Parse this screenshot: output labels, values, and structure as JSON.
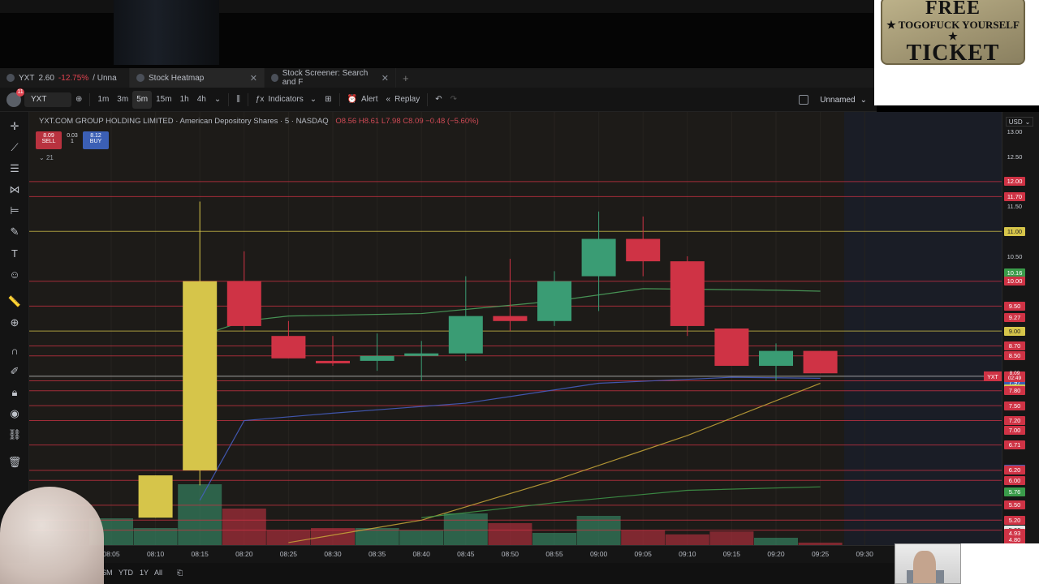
{
  "tabs": [
    {
      "icon": "tradingview-icon",
      "label": "YXT",
      "price": "2.60",
      "change": "-12.75%",
      "suffix": "/ Unna",
      "active": false
    },
    {
      "icon": "heatmap-icon",
      "label": "Stock Heatmap",
      "active": true
    },
    {
      "icon": "screener-icon",
      "label": "Stock Screener: Search and F",
      "active": false
    }
  ],
  "toolbar": {
    "avatar_badge": "11",
    "symbol": "YXT",
    "intervals": [
      "1m",
      "3m",
      "5m",
      "15m",
      "1h",
      "4h"
    ],
    "selected_interval": "5m",
    "indicators": "Indicators",
    "alert": "Alert",
    "replay": "Replay",
    "layout_name": "Unnamed"
  },
  "legend": {
    "title": "YXT.COM GROUP HOLDING LIMITED · American Depository Shares · 5 · NASDAQ",
    "ohlc": "O8.56 H8.61 L7.98 C8.09 −0.48 (−5.60%)"
  },
  "trade": {
    "sell_price": "8.09",
    "sell_label": "SELL",
    "spread": "0.03",
    "qty": "1",
    "buy_price": "8.12",
    "buy_label": "BUY"
  },
  "interval_tag": "21",
  "currency": "USD",
  "colors": {
    "up": "#3a9c74",
    "down": "#cf3345",
    "yellow": "#d6c54a",
    "bg": "#1d1b18"
  },
  "chart_data": {
    "type": "candlestick",
    "x": [
      "08:05",
      "08:10",
      "08:15",
      "08:20",
      "08:25",
      "08:30",
      "08:35",
      "08:40",
      "08:45",
      "08:50",
      "08:55",
      "09:00",
      "09:05",
      "09:10",
      "09:15",
      "09:20",
      "09:25"
    ],
    "ohlc": [
      {
        "t": "08:10",
        "o": 5.25,
        "h": 5.6,
        "l": 5.25,
        "c": 6.1,
        "color": "yellow"
      },
      {
        "t": "08:15",
        "o": 6.2,
        "h": 11.6,
        "l": 5.9,
        "c": 10.0,
        "color": "yellow"
      },
      {
        "t": "08:20",
        "o": 10.0,
        "h": 10.6,
        "l": 9.0,
        "c": 9.1,
        "color": "down"
      },
      {
        "t": "08:25",
        "o": 8.9,
        "h": 9.2,
        "l": 8.45,
        "c": 8.45,
        "color": "down"
      },
      {
        "t": "08:30",
        "o": 8.4,
        "h": 8.9,
        "l": 8.3,
        "c": 8.35,
        "color": "down"
      },
      {
        "t": "08:35",
        "o": 8.4,
        "h": 8.95,
        "l": 8.2,
        "c": 8.5,
        "color": "up"
      },
      {
        "t": "08:40",
        "o": 8.5,
        "h": 8.8,
        "l": 8.0,
        "c": 8.55,
        "color": "up"
      },
      {
        "t": "08:45",
        "o": 8.55,
        "h": 10.1,
        "l": 8.4,
        "c": 9.3,
        "color": "up"
      },
      {
        "t": "08:50",
        "o": 9.3,
        "h": 10.45,
        "l": 9.0,
        "c": 9.2,
        "color": "down"
      },
      {
        "t": "08:55",
        "o": 9.2,
        "h": 10.2,
        "l": 9.1,
        "c": 10.0,
        "color": "up"
      },
      {
        "t": "09:00",
        "o": 10.1,
        "h": 11.4,
        "l": 9.4,
        "c": 10.85,
        "color": "up"
      },
      {
        "t": "09:05",
        "o": 10.85,
        "h": 11.3,
        "l": 10.1,
        "c": 10.4,
        "color": "down"
      },
      {
        "t": "09:10",
        "o": 10.4,
        "h": 10.5,
        "l": 8.9,
        "c": 9.1,
        "color": "down"
      },
      {
        "t": "09:15",
        "o": 9.05,
        "h": 9.05,
        "l": 8.3,
        "c": 8.3,
        "color": "down"
      },
      {
        "t": "09:20",
        "o": 8.3,
        "h": 8.75,
        "l": 8.0,
        "c": 8.6,
        "color": "up"
      },
      {
        "t": "09:25",
        "o": 8.6,
        "h": 8.6,
        "l": 8.15,
        "c": 8.15,
        "color": "down"
      }
    ],
    "volume": [
      {
        "t": "08:05",
        "v": 0.55,
        "color": "up"
      },
      {
        "t": "08:10",
        "v": 0.35,
        "color": "up"
      },
      {
        "t": "08:15",
        "v": 1.25,
        "color": "up"
      },
      {
        "t": "08:20",
        "v": 0.75,
        "color": "down"
      },
      {
        "t": "08:25",
        "v": 0.3,
        "color": "down"
      },
      {
        "t": "08:30",
        "v": 0.35,
        "color": "down"
      },
      {
        "t": "08:35",
        "v": 0.35,
        "color": "up"
      },
      {
        "t": "08:40",
        "v": 0.3,
        "color": "up"
      },
      {
        "t": "08:45",
        "v": 0.65,
        "color": "up"
      },
      {
        "t": "08:50",
        "v": 0.45,
        "color": "down"
      },
      {
        "t": "08:55",
        "v": 0.25,
        "color": "up"
      },
      {
        "t": "09:00",
        "v": 0.6,
        "color": "up"
      },
      {
        "t": "09:05",
        "v": 0.3,
        "color": "down"
      },
      {
        "t": "09:10",
        "v": 0.22,
        "color": "down"
      },
      {
        "t": "09:15",
        "v": 0.28,
        "color": "down"
      },
      {
        "t": "09:20",
        "v": 0.15,
        "color": "up"
      },
      {
        "t": "09:25",
        "v": 0.05,
        "color": "down"
      }
    ],
    "ylim": [
      4.7,
      13.4
    ],
    "hlines": [
      {
        "y": 12.0,
        "color": "#cf3345"
      },
      {
        "y": 11.7,
        "color": "#cf3345"
      },
      {
        "y": 11.0,
        "color": "#d6c54a"
      },
      {
        "y": 10.0,
        "color": "#cf3345"
      },
      {
        "y": 9.5,
        "color": "#cf3345"
      },
      {
        "y": 9.0,
        "color": "#d6c54a"
      },
      {
        "y": 8.7,
        "color": "#cf3345"
      },
      {
        "y": 8.5,
        "color": "#cf3345"
      },
      {
        "y": 8.09,
        "color": "#c8c8c8"
      },
      {
        "y": 8.0,
        "color": "#cf3345"
      },
      {
        "y": 7.8,
        "color": "#cf3345"
      },
      {
        "y": 7.5,
        "color": "#cf3345"
      },
      {
        "y": 7.2,
        "color": "#cf3345"
      },
      {
        "y": 6.71,
        "color": "#cf3345"
      },
      {
        "y": 6.2,
        "color": "#cf3345"
      },
      {
        "y": 6.0,
        "color": "#cf3345"
      },
      {
        "y": 5.5,
        "color": "#cf3345"
      },
      {
        "y": 5.2,
        "color": "#cf3345"
      },
      {
        "y": 5.0,
        "color": "#cf3345"
      }
    ],
    "price_labels": [
      {
        "y": 13.0,
        "text": "13.00",
        "bg": "",
        "fg": "#c8ccd3"
      },
      {
        "y": 12.5,
        "text": "12.50",
        "bg": "",
        "fg": "#c8ccd3"
      },
      {
        "y": 12.0,
        "text": "12.00",
        "bg": "#cf3345",
        "fg": "#fff"
      },
      {
        "y": 11.7,
        "text": "11.70",
        "bg": "#cf3345",
        "fg": "#fff"
      },
      {
        "y": 11.5,
        "text": "11.50",
        "bg": "",
        "fg": "#c8ccd3"
      },
      {
        "y": 11.0,
        "text": "11.00",
        "bg": "#d6c54a",
        "fg": "#222"
      },
      {
        "y": 10.5,
        "text": "10.50",
        "bg": "",
        "fg": "#c8ccd3"
      },
      {
        "y": 10.16,
        "text": "10.16",
        "bg": "#3a9c4a",
        "fg": "#fff"
      },
      {
        "y": 10.0,
        "text": "10.00",
        "bg": "#cf3345",
        "fg": "#fff"
      },
      {
        "y": 9.5,
        "text": "9.50",
        "bg": "#cf3345",
        "fg": "#fff"
      },
      {
        "y": 9.27,
        "text": "9.27",
        "bg": "#cf3345",
        "fg": "#fff"
      },
      {
        "y": 9.0,
        "text": "9.00",
        "bg": "#d6c54a",
        "fg": "#222"
      },
      {
        "y": 8.7,
        "text": "8.70",
        "bg": "#cf3345",
        "fg": "#fff"
      },
      {
        "y": 8.5,
        "text": "8.50",
        "bg": "#cf3345",
        "fg": "#fff"
      },
      {
        "y": 8.0,
        "text": "8.00",
        "bg": "#e8e8e8",
        "fg": "#222"
      },
      {
        "y": 7.97,
        "text": "7.97",
        "bg": "#3b5fb5",
        "fg": "#fff"
      },
      {
        "y": 7.84,
        "text": "7.84",
        "bg": "#d6c54a",
        "fg": "#222"
      },
      {
        "y": 7.8,
        "text": "7.80",
        "bg": "#cf3345",
        "fg": "#fff"
      },
      {
        "y": 7.5,
        "text": "7.50",
        "bg": "#cf3345",
        "fg": "#fff"
      },
      {
        "y": 7.2,
        "text": "7.20",
        "bg": "#cf3345",
        "fg": "#fff"
      },
      {
        "y": 7.0,
        "text": "7.00",
        "bg": "#cf3345",
        "fg": "#fff"
      },
      {
        "y": 6.71,
        "text": "6.71",
        "bg": "#cf3345",
        "fg": "#fff"
      },
      {
        "y": 6.22,
        "text": "6.22",
        "bg": "#3b5fb5",
        "fg": "#fff"
      },
      {
        "y": 6.2,
        "text": "6.20",
        "bg": "#cf3345",
        "fg": "#fff"
      },
      {
        "y": 6.0,
        "text": "6.00",
        "bg": "#cf3345",
        "fg": "#fff"
      },
      {
        "y": 5.76,
        "text": "5.76",
        "bg": "#3a9c4a",
        "fg": "#fff"
      },
      {
        "y": 5.5,
        "text": "5.50",
        "bg": "#cf3345",
        "fg": "#fff"
      },
      {
        "y": 5.2,
        "text": "5.20",
        "bg": "#cf3345",
        "fg": "#fff"
      },
      {
        "y": 5.0,
        "text": "5.00",
        "bg": "#e8e8e8",
        "fg": "#222"
      },
      {
        "y": 4.93,
        "text": "4.93",
        "bg": "#cf3345",
        "fg": "#fff"
      },
      {
        "y": 4.8,
        "text": "4.80",
        "bg": "#cf3345",
        "fg": "#fff"
      }
    ],
    "last_price": {
      "symbol": "YXT",
      "price": "8.09",
      "countdown": "02:49"
    },
    "xticks": [
      "08:05",
      "08:10",
      "08:15",
      "08:20",
      "08:25",
      "08:30",
      "08:35",
      "08:40",
      "08:45",
      "08:50",
      "08:55",
      "09:00",
      "09:05",
      "09:10",
      "09:15",
      "09:20",
      "09:25",
      "09:30"
    ]
  },
  "ranges": [
    "6M",
    "YTD",
    "1Y",
    "All"
  ],
  "overlay_sign": {
    "line1": "FREE",
    "line2": "★ TOGOFUCK YOURSELF ★",
    "line3": "TICKET"
  }
}
